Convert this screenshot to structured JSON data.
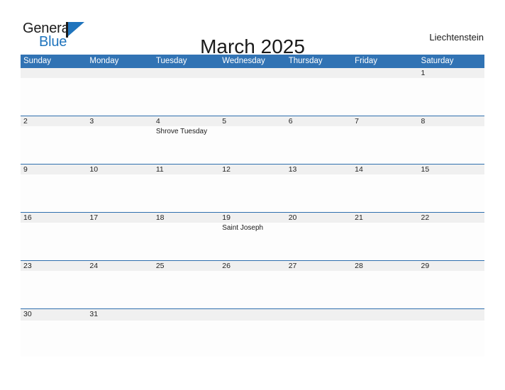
{
  "brand": {
    "name_part1": "General",
    "name_part2": "Blue",
    "flag_icon": "flag-icon",
    "accent_color": "#1f74bd"
  },
  "header": {
    "title": "March 2025",
    "region": "Liechtenstein"
  },
  "colors": {
    "header_blue": "#3173b4",
    "row_divider_blue": "#2f6fae",
    "band_gray": "#f0f0f0",
    "text": "#1a1a1a"
  },
  "calendar": {
    "month": "March",
    "year": "2025",
    "weekdays": [
      "Sunday",
      "Monday",
      "Tuesday",
      "Wednesday",
      "Thursday",
      "Friday",
      "Saturday"
    ],
    "weeks": [
      {
        "days": [
          {
            "number": "",
            "events": []
          },
          {
            "number": "",
            "events": []
          },
          {
            "number": "",
            "events": []
          },
          {
            "number": "",
            "events": []
          },
          {
            "number": "",
            "events": []
          },
          {
            "number": "",
            "events": []
          },
          {
            "number": "1",
            "events": []
          }
        ]
      },
      {
        "days": [
          {
            "number": "2",
            "events": []
          },
          {
            "number": "3",
            "events": []
          },
          {
            "number": "4",
            "events": [
              "Shrove Tuesday"
            ]
          },
          {
            "number": "5",
            "events": []
          },
          {
            "number": "6",
            "events": []
          },
          {
            "number": "7",
            "events": []
          },
          {
            "number": "8",
            "events": []
          }
        ]
      },
      {
        "days": [
          {
            "number": "9",
            "events": []
          },
          {
            "number": "10",
            "events": []
          },
          {
            "number": "11",
            "events": []
          },
          {
            "number": "12",
            "events": []
          },
          {
            "number": "13",
            "events": []
          },
          {
            "number": "14",
            "events": []
          },
          {
            "number": "15",
            "events": []
          }
        ]
      },
      {
        "days": [
          {
            "number": "16",
            "events": []
          },
          {
            "number": "17",
            "events": []
          },
          {
            "number": "18",
            "events": []
          },
          {
            "number": "19",
            "events": [
              "Saint Joseph"
            ]
          },
          {
            "number": "20",
            "events": []
          },
          {
            "number": "21",
            "events": []
          },
          {
            "number": "22",
            "events": []
          }
        ]
      },
      {
        "days": [
          {
            "number": "23",
            "events": []
          },
          {
            "number": "24",
            "events": []
          },
          {
            "number": "25",
            "events": []
          },
          {
            "number": "26",
            "events": []
          },
          {
            "number": "27",
            "events": []
          },
          {
            "number": "28",
            "events": []
          },
          {
            "number": "29",
            "events": []
          }
        ]
      },
      {
        "days": [
          {
            "number": "30",
            "events": []
          },
          {
            "number": "31",
            "events": []
          },
          {
            "number": "",
            "events": []
          },
          {
            "number": "",
            "events": []
          },
          {
            "number": "",
            "events": []
          },
          {
            "number": "",
            "events": []
          },
          {
            "number": "",
            "events": []
          }
        ]
      }
    ]
  }
}
